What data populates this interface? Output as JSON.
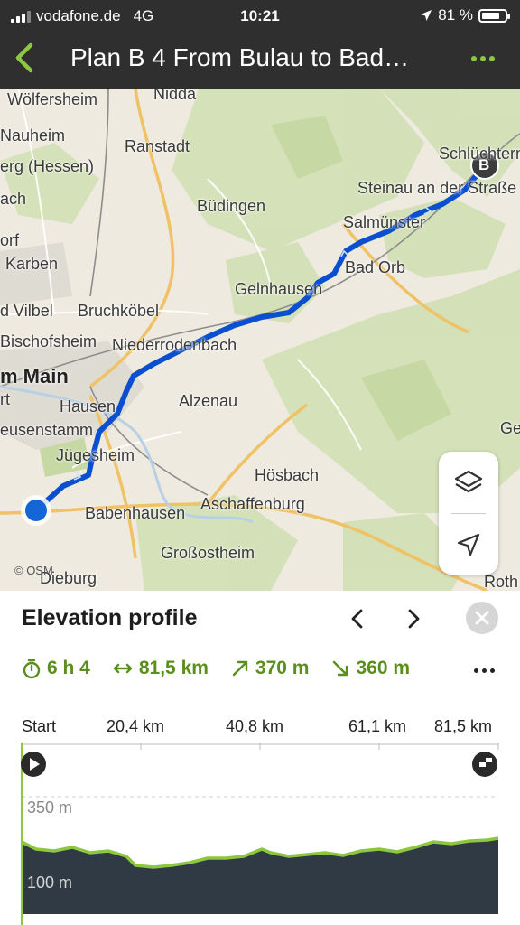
{
  "status": {
    "carrier": "vodafone.de",
    "network": "4G",
    "time": "10:21",
    "battery": "81 %",
    "battery_level": 0.81
  },
  "header": {
    "title": "Plan B 4 From Bulau to Bad…"
  },
  "map": {
    "places": [
      "Nidda",
      "Wölfersheim",
      "Nauheim",
      "erg (Hessen)",
      "Ranstadt",
      "ach",
      "Büdingen",
      "orf",
      "Karben",
      "d Vilbel",
      "Bruchköbel",
      "Bischofsheim",
      "Niederrodenbach",
      "m Main",
      "rt",
      "Hausen",
      "Alzenau",
      "eusenstamm",
      "Jügesheim",
      "Hösbach",
      "Babenhausen",
      "Aschaffenburg",
      "Großostheim",
      "Dieburg",
      "Gelnhausen",
      "Bad Orb",
      "Salmünster",
      "Steinau an der Straße",
      "Schlüchtern",
      "Ge",
      "Roth"
    ],
    "attribution": "© OSM",
    "end_marker": "B",
    "route_color": "#0a4fd0",
    "layers_icon": "layers-icon",
    "locate_icon": "navigation-arrow-icon"
  },
  "elevation": {
    "title": "Elevation profile",
    "duration": "6 h 4",
    "distance": "81,5 km",
    "ascent": "370 m",
    "descent": "360 m",
    "x_ticks": [
      "Start",
      "20,4 km",
      "40,8 km",
      "61,1 km",
      "81,5 km"
    ],
    "y_labels": [
      "350 m",
      "100 m"
    ],
    "accent": "#8dc63f"
  }
}
